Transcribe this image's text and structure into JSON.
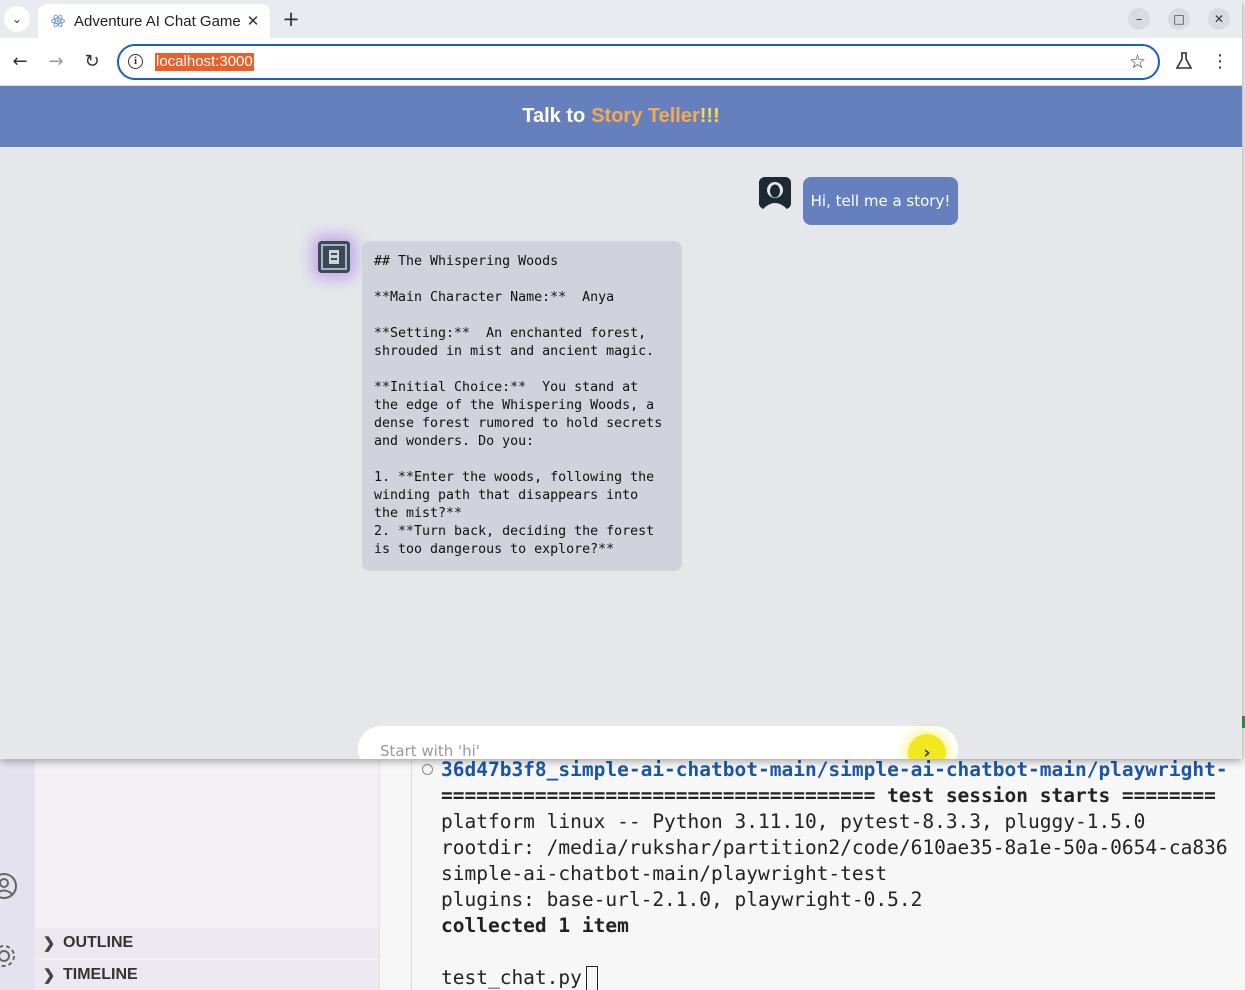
{
  "browser": {
    "tab_title": "Adventure AI Chat Game",
    "url": "localhost:3000"
  },
  "app": {
    "header_prefix": "Talk to",
    "header_accent": "Story Teller",
    "header_exclaim": "!!!"
  },
  "chat": {
    "user_message": "Hi, tell me a story!",
    "bot_message": "## The Whispering Woods\n\n**Main Character Name:**  Anya\n\n**Setting:**  An enchanted forest, shrouded in mist and ancient magic.\n\n**Initial Choice:**  You stand at the edge of the Whispering Woods, a dense forest rumored to hold secrets and wonders. Do you:\n\n1. **Enter the woods, following the winding path that disappears into the mist?**\n2. **Turn back, deciding the forest is too dangerous to explore?**",
    "input_placeholder": "Start with 'hi'"
  },
  "ide": {
    "sections": [
      "OUTLINE",
      "TIMELINE"
    ],
    "terminal_lines": [
      "36d47b3f8_simple-ai-chatbot-main/simple-ai-chatbot-main/playwright-",
      "===================================== test session starts ========",
      "platform linux -- Python 3.11.10, pytest-8.3.3, pluggy-1.5.0",
      "rootdir: /media/rukshar/partition2/code/610ae35-8a1e-50a-0654-ca836",
      "simple-ai-chatbot-main/playwright-test",
      "plugins: base-url-2.1.0, playwright-0.5.2",
      "collected 1 item",
      "test_chat.py"
    ]
  }
}
